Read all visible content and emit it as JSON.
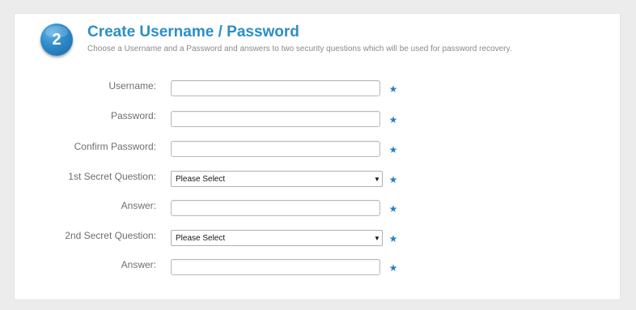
{
  "section": {
    "step_number": "2",
    "title": "Create Username / Password",
    "description": "Choose a Username and a Password and answers to two security questions which will be used for password recovery."
  },
  "form": {
    "username": {
      "label": "Username:",
      "value": "",
      "required_icon": "★"
    },
    "password": {
      "label": "Password:",
      "value": "",
      "required_icon": "★"
    },
    "confirm_password": {
      "label": "Confirm Password:",
      "value": "",
      "required_icon": "★"
    },
    "secret_question_1": {
      "label": "1st Secret Question:",
      "selected": "Please Select",
      "arrow": "▼",
      "required_icon": "★"
    },
    "answer_1": {
      "label": "Answer:",
      "value": "",
      "required_icon": "★"
    },
    "secret_question_2": {
      "label": "2nd Secret Question:",
      "selected": "Please Select",
      "arrow": "▼",
      "required_icon": "★"
    },
    "answer_2": {
      "label": "Answer:",
      "value": "",
      "required_icon": "★"
    }
  },
  "icons": {
    "required": "star-icon",
    "dropdown": "chevron-down-icon"
  },
  "colors": {
    "accent": "#2b8ec8",
    "badge": "#2d89c7",
    "required_star": "#2a7fc0",
    "label": "#6f6f6f",
    "background": "#ececec",
    "panel": "#ffffff"
  }
}
